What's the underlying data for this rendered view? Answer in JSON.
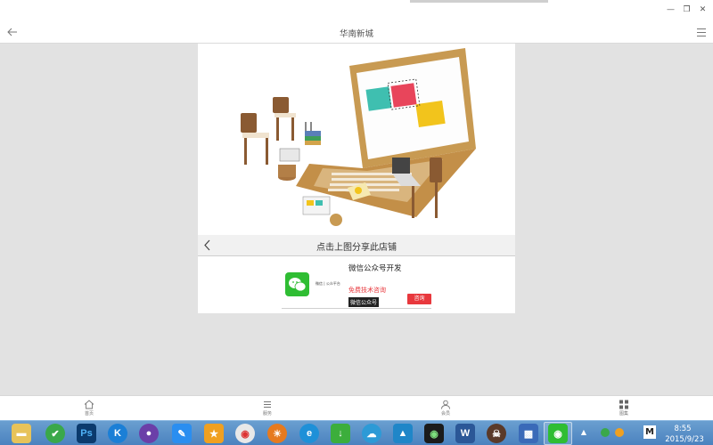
{
  "window": {
    "min_icon": "minimize-icon",
    "restore_icon": "restore-icon",
    "close_icon": "close-icon"
  },
  "header": {
    "title": "华南新城",
    "back_icon": "back-arrow-icon",
    "menu_icon": "hamburger-menu-icon"
  },
  "hero": {
    "image_description_icon": "laptop-illustration-image"
  },
  "share": {
    "text": "点击上图分享此店铺",
    "chevron_icon": "chevron-left-icon"
  },
  "ad": {
    "title": "微信公众号开发",
    "wechat_small": "微信 | 公众平台",
    "free": "免费技术咨询",
    "tag": "微信公众号",
    "consult_button": "咨询"
  },
  "bottom_nav": [
    {
      "label": "首页",
      "icon": "home-icon"
    },
    {
      "label": "服务",
      "icon": "list-icon"
    },
    {
      "label": "会员",
      "icon": "user-icon"
    },
    {
      "label": "图集",
      "icon": "grid-icon"
    }
  ],
  "taskbar": {
    "time": "8:55",
    "date": "2015/9/23",
    "ime": "M",
    "tray_arrow": "▲",
    "colors": {
      "taskbar": "#4b82bf",
      "accent_red": "#e8383d",
      "wechat_green": "#2fbd33"
    }
  }
}
